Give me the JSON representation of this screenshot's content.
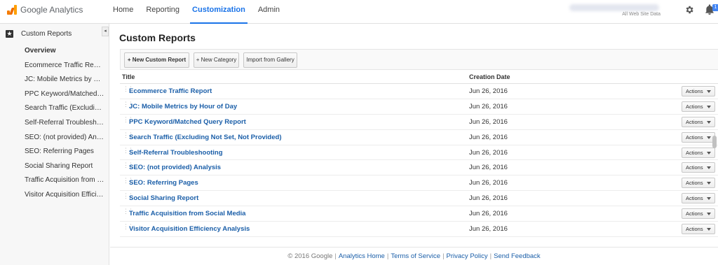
{
  "app": {
    "name": "Google Analytics"
  },
  "nav": {
    "items": [
      "Home",
      "Reporting",
      "Customization",
      "Admin"
    ],
    "active": "Customization"
  },
  "account": {
    "subtitle": "All Web Site Data"
  },
  "header_icons": {
    "settings": "gear-icon",
    "notifications": "bell-icon",
    "notification_badge": "1"
  },
  "sidebar": {
    "title": "Custom Reports",
    "collapse_glyph": "◂",
    "items": [
      {
        "label": "Overview",
        "active": true
      },
      {
        "label": "Ecommerce Traffic Report"
      },
      {
        "label": "JC: Mobile Metrics by Ho..."
      },
      {
        "label": "PPC Keyword/Matched Q..."
      },
      {
        "label": "Search Traffic (Excluding..."
      },
      {
        "label": "Self-Referral Troubleshoo..."
      },
      {
        "label": "SEO: (not provided) Anal..."
      },
      {
        "label": "SEO: Referring Pages"
      },
      {
        "label": "Social Sharing Report"
      },
      {
        "label": "Traffic Acquisition from S..."
      },
      {
        "label": "Visitor Acquisition Efficie..."
      }
    ]
  },
  "main": {
    "title": "Custom Reports",
    "toolbar": {
      "new_report": "+ New Custom Report",
      "new_category": "+ New Category",
      "import": "Import from Gallery"
    },
    "columns": {
      "title": "Title",
      "date": "Creation Date"
    },
    "actions_label": "Actions",
    "rows": [
      {
        "title": "Ecommerce Traffic Report",
        "date": "Jun 26, 2016"
      },
      {
        "title": "JC: Mobile Metrics by Hour of Day",
        "date": "Jun 26, 2016"
      },
      {
        "title": "PPC Keyword/Matched Query Report",
        "date": "Jun 26, 2016"
      },
      {
        "title": "Search Traffic (Excluding Not Set, Not Provided)",
        "date": "Jun 26, 2016"
      },
      {
        "title": "Self-Referral Troubleshooting",
        "date": "Jun 26, 2016"
      },
      {
        "title": "SEO: (not provided) Analysis",
        "date": "Jun 26, 2016"
      },
      {
        "title": "SEO: Referring Pages",
        "date": "Jun 26, 2016"
      },
      {
        "title": "Social Sharing Report",
        "date": "Jun 26, 2016"
      },
      {
        "title": "Traffic Acquisition from Social Media",
        "date": "Jun 26, 2016"
      },
      {
        "title": "Visitor Acquisition Efficiency Analysis",
        "date": "Jun 26, 2016"
      }
    ]
  },
  "footer": {
    "copyright": "© 2016 Google",
    "links": [
      "Analytics Home",
      "Terms of Service",
      "Privacy Policy",
      "Send Feedback"
    ]
  },
  "colors": {
    "accent": "#1a73e8",
    "link": "#1a5ea8"
  }
}
